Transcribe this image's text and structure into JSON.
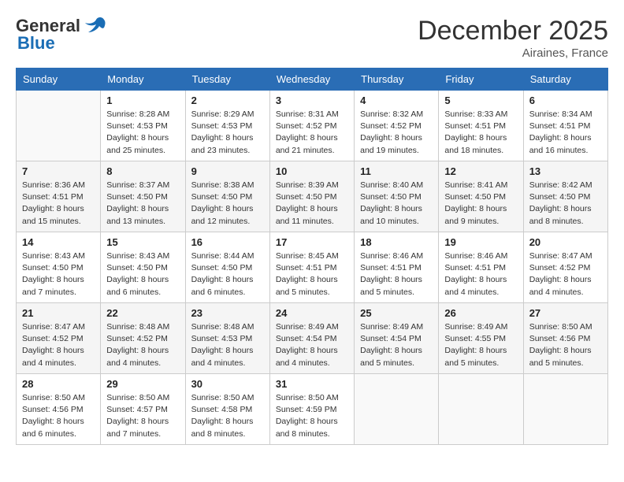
{
  "header": {
    "logo_general": "General",
    "logo_blue": "Blue",
    "month": "December 2025",
    "location": "Airaines, France"
  },
  "days_of_week": [
    "Sunday",
    "Monday",
    "Tuesday",
    "Wednesday",
    "Thursday",
    "Friday",
    "Saturday"
  ],
  "weeks": [
    [
      {
        "day": "",
        "info": ""
      },
      {
        "day": "1",
        "info": "Sunrise: 8:28 AM\nSunset: 4:53 PM\nDaylight: 8 hours\nand 25 minutes."
      },
      {
        "day": "2",
        "info": "Sunrise: 8:29 AM\nSunset: 4:53 PM\nDaylight: 8 hours\nand 23 minutes."
      },
      {
        "day": "3",
        "info": "Sunrise: 8:31 AM\nSunset: 4:52 PM\nDaylight: 8 hours\nand 21 minutes."
      },
      {
        "day": "4",
        "info": "Sunrise: 8:32 AM\nSunset: 4:52 PM\nDaylight: 8 hours\nand 19 minutes."
      },
      {
        "day": "5",
        "info": "Sunrise: 8:33 AM\nSunset: 4:51 PM\nDaylight: 8 hours\nand 18 minutes."
      },
      {
        "day": "6",
        "info": "Sunrise: 8:34 AM\nSunset: 4:51 PM\nDaylight: 8 hours\nand 16 minutes."
      }
    ],
    [
      {
        "day": "7",
        "info": "Sunrise: 8:36 AM\nSunset: 4:51 PM\nDaylight: 8 hours\nand 15 minutes."
      },
      {
        "day": "8",
        "info": "Sunrise: 8:37 AM\nSunset: 4:50 PM\nDaylight: 8 hours\nand 13 minutes."
      },
      {
        "day": "9",
        "info": "Sunrise: 8:38 AM\nSunset: 4:50 PM\nDaylight: 8 hours\nand 12 minutes."
      },
      {
        "day": "10",
        "info": "Sunrise: 8:39 AM\nSunset: 4:50 PM\nDaylight: 8 hours\nand 11 minutes."
      },
      {
        "day": "11",
        "info": "Sunrise: 8:40 AM\nSunset: 4:50 PM\nDaylight: 8 hours\nand 10 minutes."
      },
      {
        "day": "12",
        "info": "Sunrise: 8:41 AM\nSunset: 4:50 PM\nDaylight: 8 hours\nand 9 minutes."
      },
      {
        "day": "13",
        "info": "Sunrise: 8:42 AM\nSunset: 4:50 PM\nDaylight: 8 hours\nand 8 minutes."
      }
    ],
    [
      {
        "day": "14",
        "info": "Sunrise: 8:43 AM\nSunset: 4:50 PM\nDaylight: 8 hours\nand 7 minutes."
      },
      {
        "day": "15",
        "info": "Sunrise: 8:43 AM\nSunset: 4:50 PM\nDaylight: 8 hours\nand 6 minutes."
      },
      {
        "day": "16",
        "info": "Sunrise: 8:44 AM\nSunset: 4:50 PM\nDaylight: 8 hours\nand 6 minutes."
      },
      {
        "day": "17",
        "info": "Sunrise: 8:45 AM\nSunset: 4:51 PM\nDaylight: 8 hours\nand 5 minutes."
      },
      {
        "day": "18",
        "info": "Sunrise: 8:46 AM\nSunset: 4:51 PM\nDaylight: 8 hours\nand 5 minutes."
      },
      {
        "day": "19",
        "info": "Sunrise: 8:46 AM\nSunset: 4:51 PM\nDaylight: 8 hours\nand 4 minutes."
      },
      {
        "day": "20",
        "info": "Sunrise: 8:47 AM\nSunset: 4:52 PM\nDaylight: 8 hours\nand 4 minutes."
      }
    ],
    [
      {
        "day": "21",
        "info": "Sunrise: 8:47 AM\nSunset: 4:52 PM\nDaylight: 8 hours\nand 4 minutes."
      },
      {
        "day": "22",
        "info": "Sunrise: 8:48 AM\nSunset: 4:52 PM\nDaylight: 8 hours\nand 4 minutes."
      },
      {
        "day": "23",
        "info": "Sunrise: 8:48 AM\nSunset: 4:53 PM\nDaylight: 8 hours\nand 4 minutes."
      },
      {
        "day": "24",
        "info": "Sunrise: 8:49 AM\nSunset: 4:54 PM\nDaylight: 8 hours\nand 4 minutes."
      },
      {
        "day": "25",
        "info": "Sunrise: 8:49 AM\nSunset: 4:54 PM\nDaylight: 8 hours\nand 5 minutes."
      },
      {
        "day": "26",
        "info": "Sunrise: 8:49 AM\nSunset: 4:55 PM\nDaylight: 8 hours\nand 5 minutes."
      },
      {
        "day": "27",
        "info": "Sunrise: 8:50 AM\nSunset: 4:56 PM\nDaylight: 8 hours\nand 5 minutes."
      }
    ],
    [
      {
        "day": "28",
        "info": "Sunrise: 8:50 AM\nSunset: 4:56 PM\nDaylight: 8 hours\nand 6 minutes."
      },
      {
        "day": "29",
        "info": "Sunrise: 8:50 AM\nSunset: 4:57 PM\nDaylight: 8 hours\nand 7 minutes."
      },
      {
        "day": "30",
        "info": "Sunrise: 8:50 AM\nSunset: 4:58 PM\nDaylight: 8 hours\nand 8 minutes."
      },
      {
        "day": "31",
        "info": "Sunrise: 8:50 AM\nSunset: 4:59 PM\nDaylight: 8 hours\nand 8 minutes."
      },
      {
        "day": "",
        "info": ""
      },
      {
        "day": "",
        "info": ""
      },
      {
        "day": "",
        "info": ""
      }
    ]
  ]
}
